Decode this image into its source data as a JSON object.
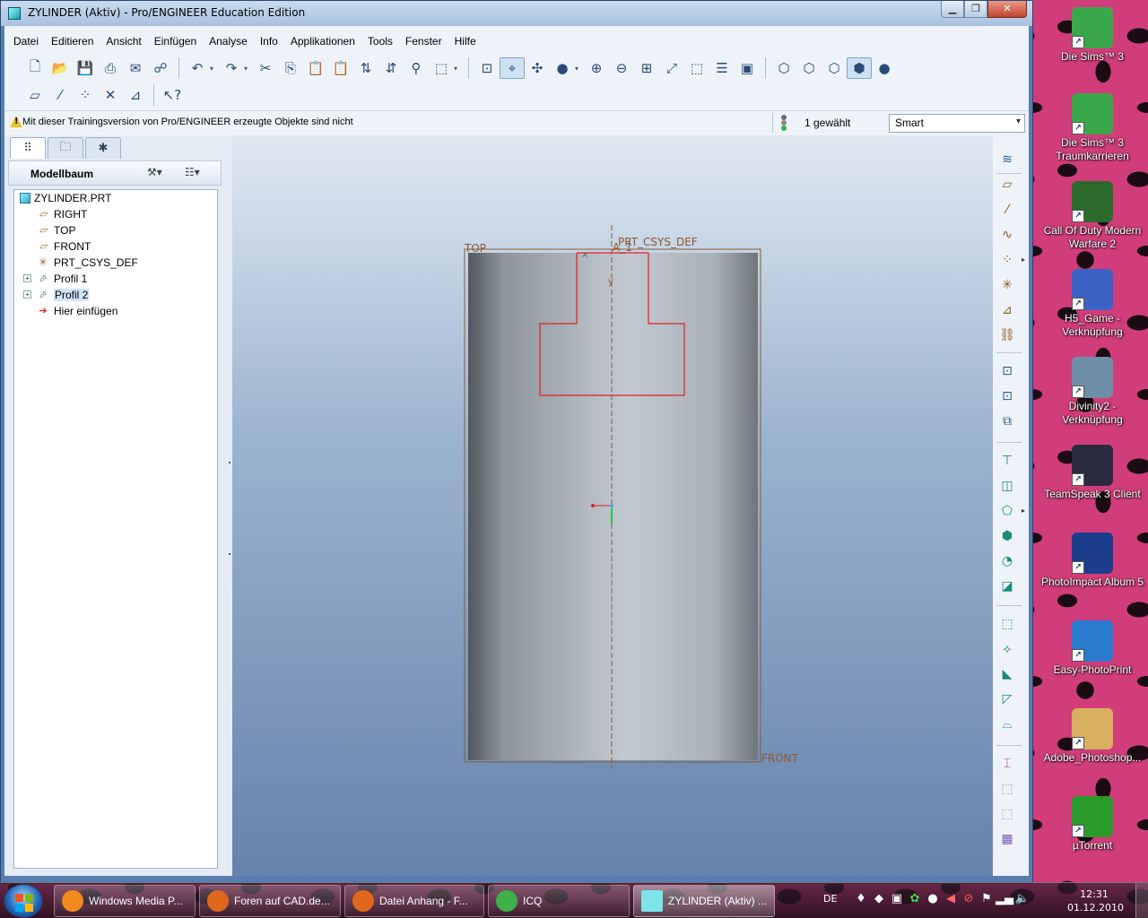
{
  "window": {
    "title": "ZYLINDER (Aktiv) - Pro/ENGINEER Education Edition",
    "controls": {
      "minimize": "▁",
      "maximize": "❐",
      "close": "✕"
    }
  },
  "menu": [
    "Datei",
    "Editieren",
    "Ansicht",
    "Einfügen",
    "Analyse",
    "Info",
    "Applikationen",
    "Tools",
    "Fenster",
    "Hilfe"
  ],
  "status": {
    "warning": "Mit dieser Trainingsversion von Pro/ENGINEER erzeugte Objekte sind nicht",
    "selected": "1 gewählt",
    "filter": "Smart"
  },
  "navigator": {
    "header": "Modellbaum",
    "tree": [
      {
        "label": "ZYLINDER.PRT",
        "icon": "part-icon"
      },
      {
        "label": "RIGHT",
        "icon": "datum-plane-icon"
      },
      {
        "label": "TOP",
        "icon": "datum-plane-icon"
      },
      {
        "label": "FRONT",
        "icon": "datum-plane-icon"
      },
      {
        "label": "PRT_CSYS_DEF",
        "icon": "csys-icon"
      },
      {
        "label": "Profil 1",
        "icon": "profile-icon"
      },
      {
        "label": "Profil 2",
        "icon": "profile-icon"
      },
      {
        "label": "Hier einfügen",
        "icon": "insert-here-icon"
      }
    ]
  },
  "graphics": {
    "datum_top": "TOP",
    "datum_front": "FRONT",
    "csys_label": "PRT_CSYS_DEF",
    "axis_label": "A_1",
    "axis_y": "y"
  },
  "desktop_icons": [
    {
      "label": "Die Sims™ 3",
      "color": "#3aa84a"
    },
    {
      "label": "Die Sims™ 3 Traumkarrieren",
      "color": "#3aa84a"
    },
    {
      "label": "Call Of Duty Modern Warfare 2",
      "color": "#2c6a2c"
    },
    {
      "label": "H5_Game - Verknüpfung",
      "color": "#3b62c5"
    },
    {
      "label": "Divinity2 - Verknüpfung",
      "color": "#6f8fa8"
    },
    {
      "label": "TeamSpeak 3 Client",
      "color": "#2a2a40"
    },
    {
      "label": "PhotoImpact Album 5",
      "color": "#1c3c8c"
    },
    {
      "label": "Easy-PhotoPrint",
      "color": "#2a7ad0"
    },
    {
      "label": "Adobe_Photoshop...",
      "color": "#d8b060"
    },
    {
      "label": "µTorrent",
      "color": "#2a9a2a"
    }
  ],
  "taskbar": {
    "tasks": [
      {
        "label": "Windows Media P...",
        "color": "#f08a1c"
      },
      {
        "label": "Foren auf CAD.de...",
        "color": "#e0681c"
      },
      {
        "label": "Datei Anhang - F...",
        "color": "#e0681c"
      },
      {
        "label": "ICQ",
        "color": "#3cb04a"
      },
      {
        "label": "ZYLINDER (Aktiv) ...",
        "color": "#7fe3ea"
      }
    ],
    "language": "DE",
    "time": "12:31",
    "date": "01.12.2010"
  }
}
